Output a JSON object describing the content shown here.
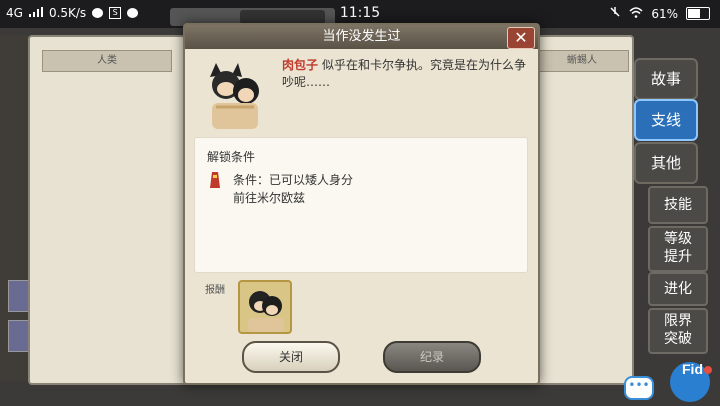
{
  "status_bar": {
    "network": "4G",
    "speed": "0.5K/s",
    "time": "11:15",
    "battery": "61%"
  },
  "background": {
    "tabs": [
      "人类",
      "蜥蜴人"
    ],
    "side_tabs": [
      {
        "label": "故事",
        "active": false
      },
      {
        "label": "支线",
        "active": true
      },
      {
        "label": "其他",
        "active": false
      }
    ],
    "side_buttons": [
      "技能",
      "等级\n提升",
      "进化",
      "限界\n突破"
    ]
  },
  "dialog": {
    "title": "当作没发生过",
    "close_symbol": "✕",
    "speaker": "肉包子",
    "story_text": "似乎在和卡尔争执。究竟是在为什么争吵呢……",
    "unlock_title": "解锁条件",
    "condition_line1": "条件：已可以矮人身分",
    "condition_line2": "前往米尔欧兹",
    "reward_label": "报酬",
    "close_button": "关闭",
    "record_button": "纪录"
  },
  "overlay": {
    "chat_icon": "•••",
    "corner_text": "Fid"
  },
  "colors": {
    "dialog_bg": "#ebe4d3",
    "header_bg": "#5a5246",
    "speaker_name": "#c0392b",
    "active_tab": "#2a6fb8"
  }
}
